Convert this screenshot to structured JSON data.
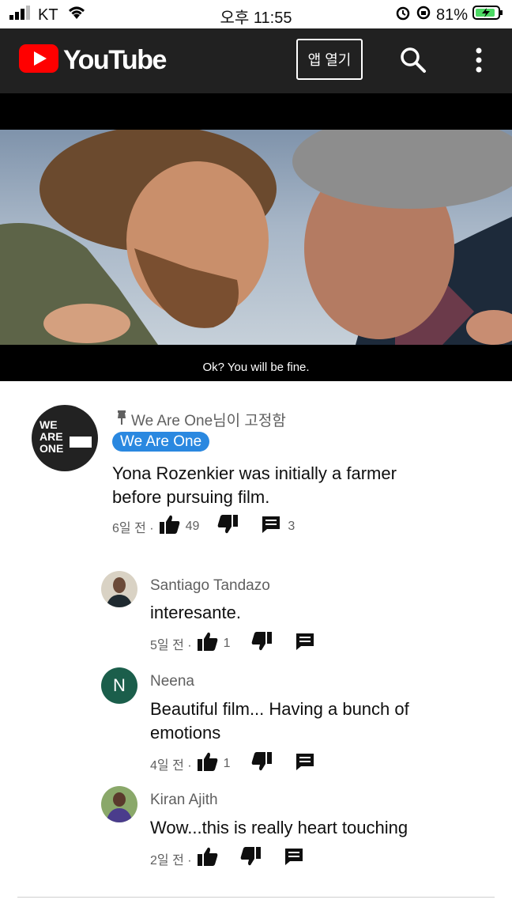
{
  "status_bar": {
    "carrier": "KT",
    "time": "오후 11:55",
    "battery": "81%"
  },
  "header": {
    "brand": "YouTube",
    "open_app_label": "앱 열기"
  },
  "video": {
    "subtitle": "Ok? You will be fine."
  },
  "pinned_comment": {
    "pinned_label": "We Are One님이 고정함",
    "author_chip": "We Are One",
    "avatar_text": "WE ARE ONE",
    "text": "Yona Rozenkier was initially a farmer before pursuing film.",
    "time": "6일 전 ·",
    "likes": "49",
    "replies": "3"
  },
  "replies": [
    {
      "author": "Santiago Tandazo",
      "text": "interesante.",
      "time": "5일 전 ·",
      "likes": "1"
    },
    {
      "author": "Neena",
      "avatar_letter": "N",
      "text": "Beautiful film...  Having a bunch of emotions",
      "time": "4일 전 ·",
      "likes": "1"
    },
    {
      "author": "Kiran Ajith",
      "text": "Wow...this is really heart touching",
      "time": "2일 전 ·",
      "likes": ""
    }
  ],
  "colors": {
    "header_bg": "#212121",
    "brand_red": "#ff0000",
    "chip_blue": "#2a88e0",
    "avatar_green": "#1b5e4b"
  }
}
